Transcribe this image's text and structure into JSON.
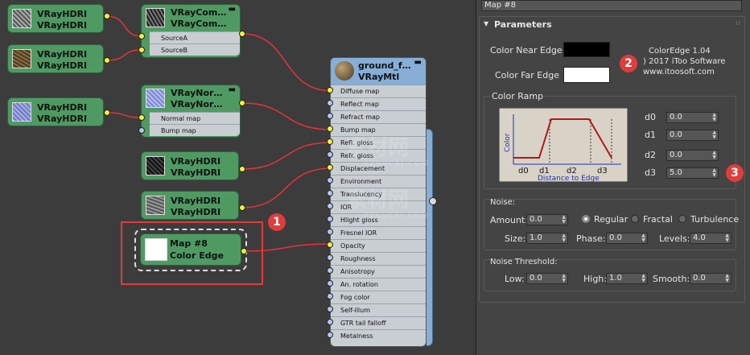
{
  "colors": {
    "wire": "#e8323c",
    "socket_input": "#f2f23a",
    "socket_free": "#b7c4ea",
    "node_green": "#4f9a63",
    "mtl_header": "#86aed7",
    "highlight": "#e03c3c"
  },
  "nodes": {
    "hdri1": {
      "line1": "VRayHDRI",
      "line2": "VRayHDRI"
    },
    "hdri2": {
      "line1": "VRayHDRI",
      "line2": "VRayHDRI"
    },
    "comp": {
      "line1": "VRayCom…",
      "line2": "VRayCom…",
      "in1": "SourceA",
      "in2": "SourceB"
    },
    "hdri3": {
      "line1": "VRayHDRI",
      "line2": "VRayHDRI"
    },
    "norm": {
      "line1": "VRayNor…",
      "line2": "VRayNor…",
      "in1": "Normal map",
      "in2": "Bump map"
    },
    "hdri4": {
      "line1": "VRayHDRI",
      "line2": "VRayHDRI"
    },
    "hdri5": {
      "line1": "VRayHDRI",
      "line2": "VRayHDRI"
    },
    "edge": {
      "line1": "Map #8",
      "line2": "Color Edge"
    }
  },
  "material": {
    "name": "ground_f…",
    "type": "VRayMtl",
    "slots": [
      "Diffuse map",
      "Reflect map",
      "Refract map",
      "Bump map",
      "Refl. gloss",
      "Refr. gloss",
      "Displacement",
      "Environment",
      "Translucency",
      "IOR",
      "Hlight gloss",
      "Fresnel IOR",
      "Opacity",
      "Roughness",
      "Anisotropy",
      "An. rotation",
      "Fog color",
      "Self-illum",
      "GTR tail falloff",
      "Metalness"
    ]
  },
  "panel": {
    "map_name": "Map #8",
    "params_title": "Parameters",
    "color_near_label": "Color Near Edge",
    "color_far_label": "Color Far Edge",
    "color_near_value": "#000000",
    "color_far_value": "#ffffff",
    "about": {
      "name": "ColorEdge 1.04",
      "copyright": ") 2017 iToo Software",
      "url": "www.itoosoft.com"
    },
    "ramp": {
      "title": "Color Ramp",
      "y_label": "Color",
      "x_label": "Distance to Edge",
      "ticks": [
        "d0",
        "d1",
        "d2",
        "d3"
      ],
      "fields": [
        {
          "label": "d0",
          "value": "0.0"
        },
        {
          "label": "d1",
          "value": "0.0"
        },
        {
          "label": "d2",
          "value": "0.0"
        },
        {
          "label": "d3",
          "value": "5.0"
        }
      ]
    },
    "noise": {
      "title": "Noise:",
      "amount_label": "Amount:",
      "amount": "0.0",
      "types": [
        "Regular",
        "Fractal",
        "Turbulence"
      ],
      "selected_type": "Regular",
      "size_label": "Size:",
      "size": "1.0",
      "phase_label": "Phase:",
      "phase": "0.0",
      "levels_label": "Levels:",
      "levels": "4.0"
    },
    "threshold": {
      "title": "Noise Threshold:",
      "low_label": "Low:",
      "low": "0.0",
      "high_label": "High:",
      "high": "1.0",
      "smooth_label": "Smooth:",
      "smooth": "0.0"
    }
  },
  "badges": [
    "1",
    "2",
    "3"
  ],
  "watermark": {
    "text": "素材网",
    "sub": "TZSUCAI.COM"
  }
}
